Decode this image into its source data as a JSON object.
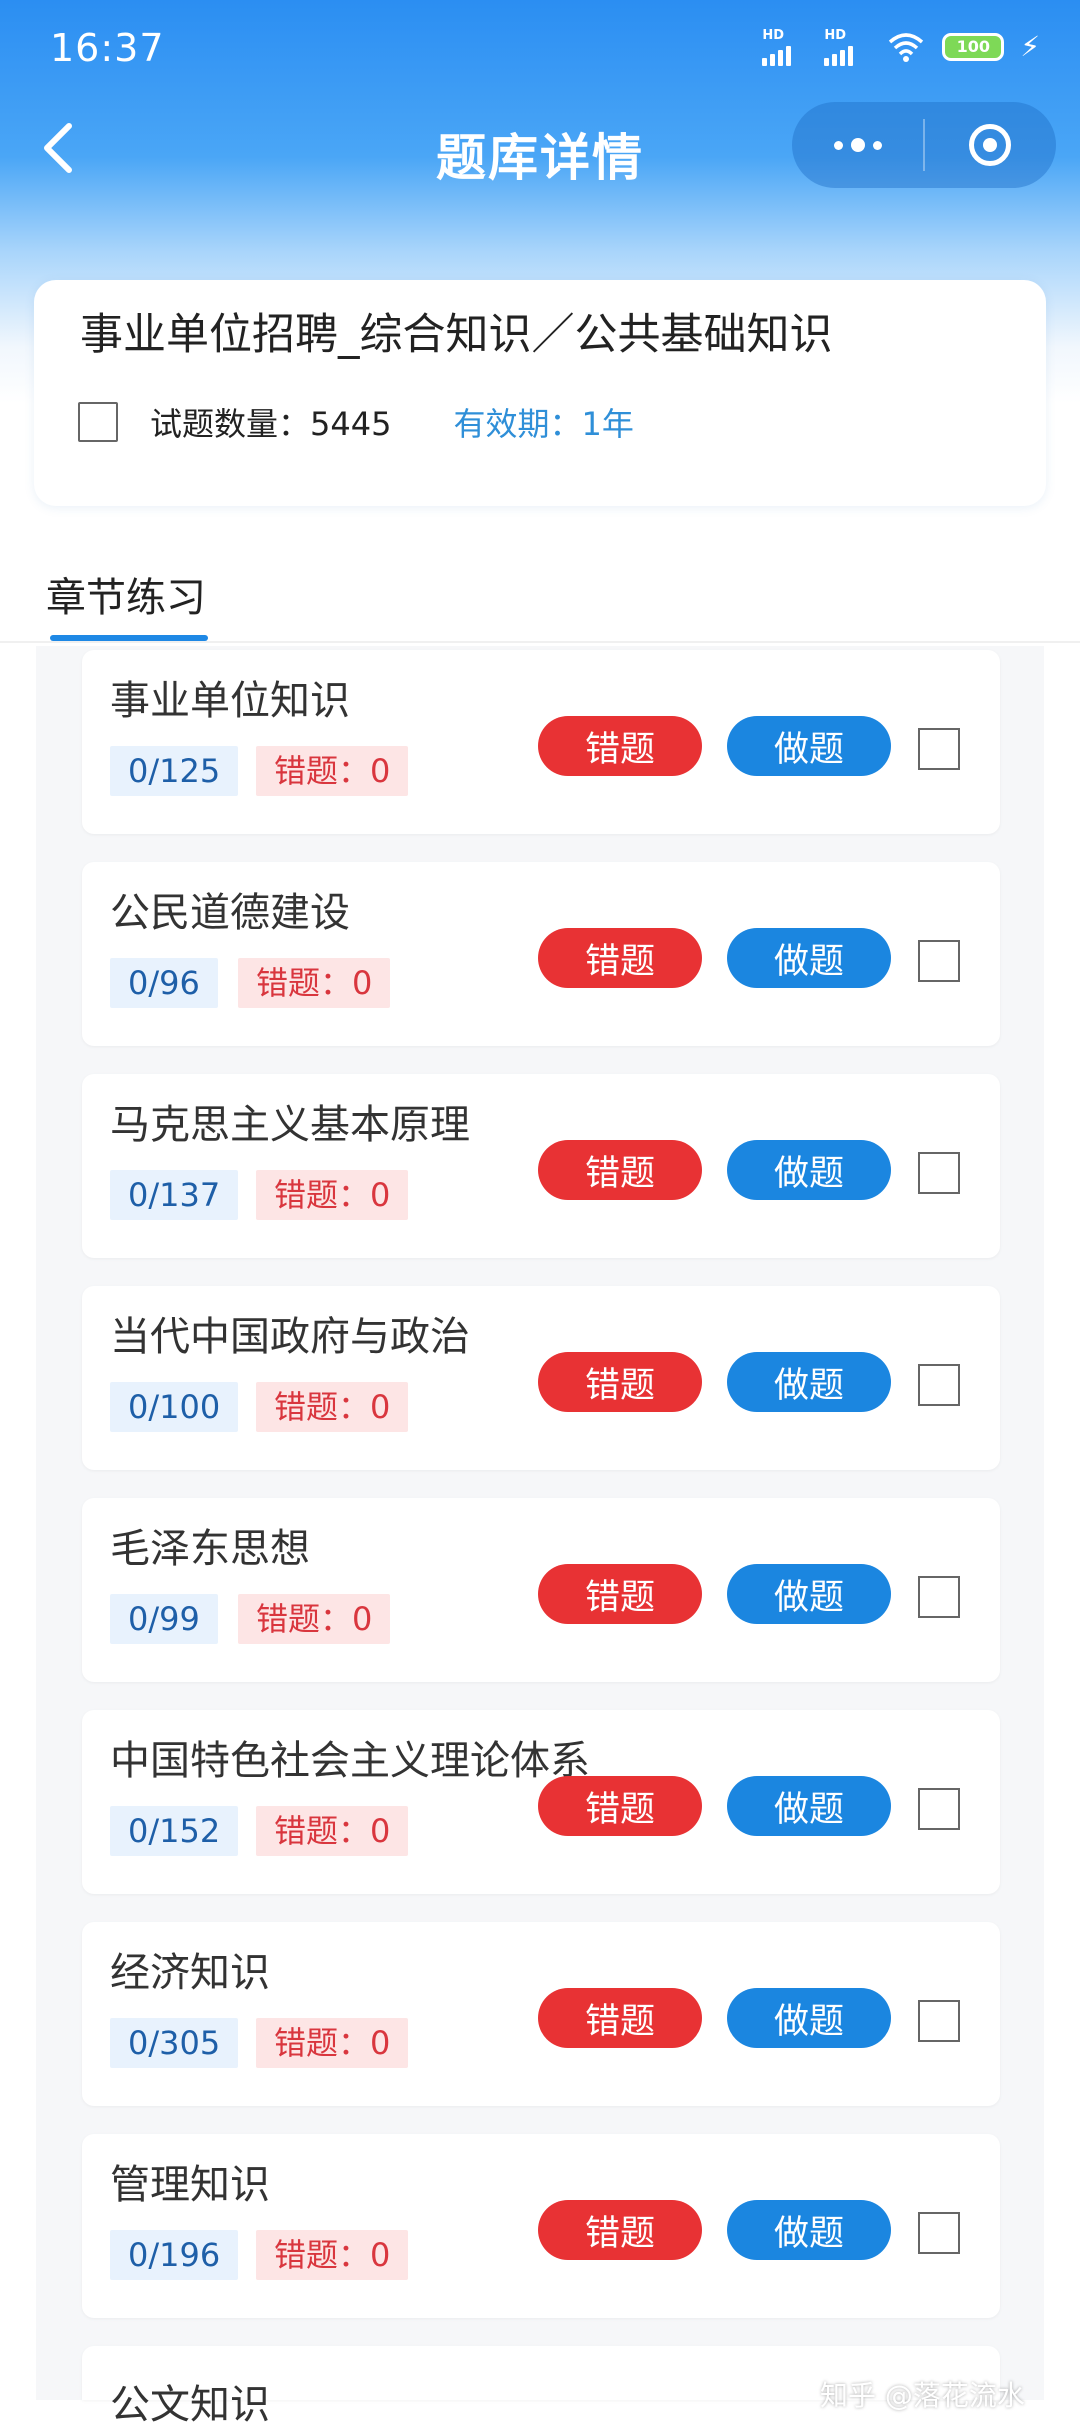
{
  "status_bar": {
    "time": "16:37",
    "signal1_label": "HD",
    "signal2_label": "HD",
    "battery": "100"
  },
  "nav": {
    "title": "题库详情",
    "icons": [
      "back-icon",
      "more-dots-icon",
      "target-icon"
    ]
  },
  "bank": {
    "title": "事业单位招聘_综合知识／公共基础知识",
    "question_count": "试题数量：5445",
    "validity": "有效期：1年"
  },
  "tabs": {
    "active": "章节练习"
  },
  "chapters": [
    {
      "name": "事业单位知识",
      "progress": "0/125",
      "wrong": "错题：0"
    },
    {
      "name": "公民道德建设",
      "progress": "0/96",
      "wrong": "错题：0"
    },
    {
      "name": "马克思主义基本原理",
      "progress": "0/137",
      "wrong": "错题：0"
    },
    {
      "name": "当代中国政府与政治",
      "progress": "0/100",
      "wrong": "错题：0"
    },
    {
      "name": "毛泽东思想",
      "progress": "0/99",
      "wrong": "错题：0"
    },
    {
      "name": "中国特色社会主义理论体系",
      "progress": "0/152",
      "wrong": "错题：0"
    },
    {
      "name": "经济知识",
      "progress": "0/305",
      "wrong": "错题：0"
    },
    {
      "name": "管理知识",
      "progress": "0/196",
      "wrong": "错题：0"
    },
    {
      "name": "公文知识",
      "progress": "",
      "wrong": ""
    }
  ],
  "buttons": {
    "wrong_label": "错题",
    "do_label": "做题"
  },
  "colors": {
    "accent": "#1b86e0",
    "wrong": "#e83234",
    "header_top": "#2b8ef2"
  },
  "watermark": "知乎 @落花流水"
}
